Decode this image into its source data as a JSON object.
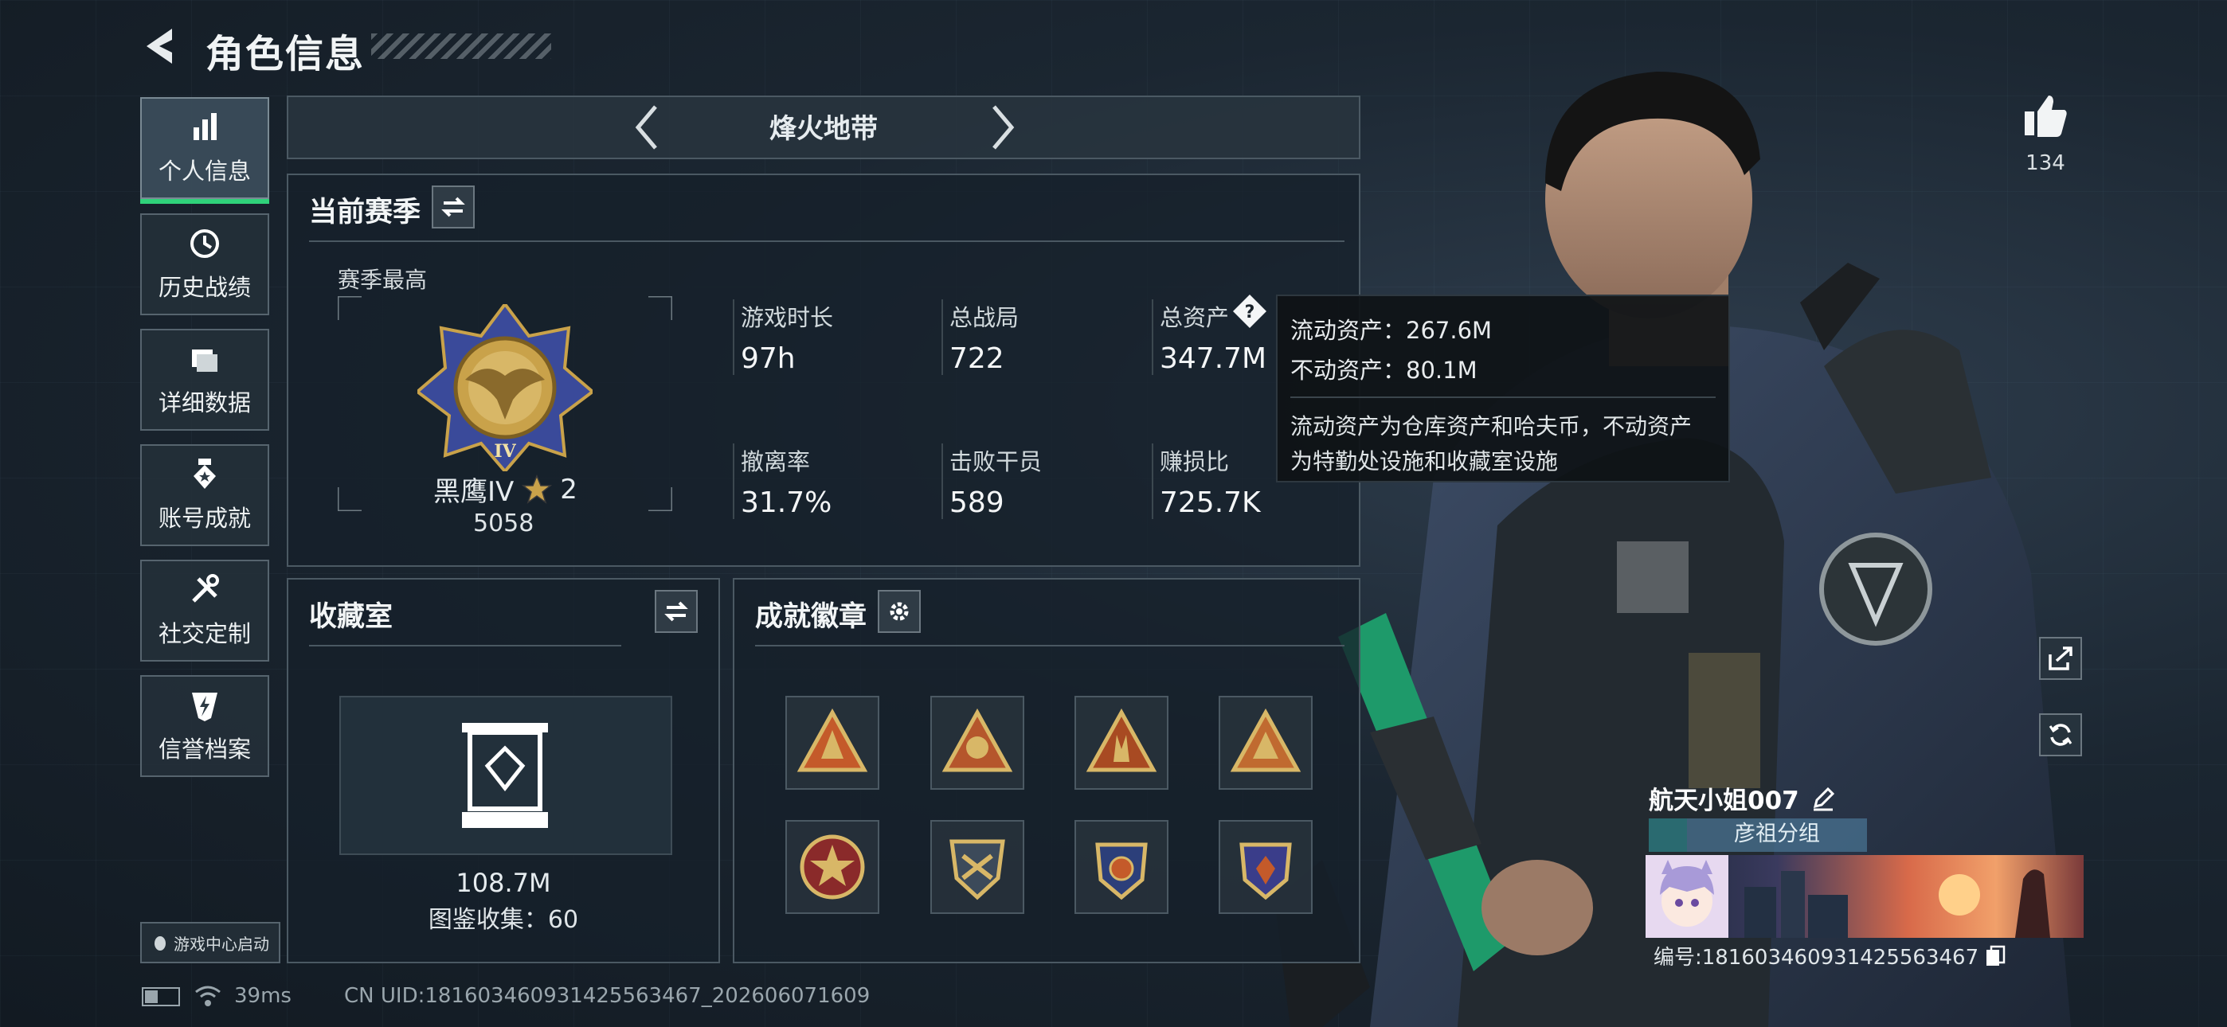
{
  "header": {
    "title": "角色信息"
  },
  "sidebar": {
    "items": [
      {
        "label": "个人信息",
        "active": true
      },
      {
        "label": "历史战绩"
      },
      {
        "label": "详细数据"
      },
      {
        "label": "账号成就"
      },
      {
        "label": "社交定制"
      },
      {
        "label": "信誉档案"
      }
    ],
    "launch_badge": "游戏中心启动"
  },
  "mode": {
    "title": "烽火地带"
  },
  "season": {
    "title": "当前赛季",
    "best_label": "赛季最高",
    "rank_name": "黑鹰IV",
    "rank_stars": "2",
    "rank_score": "5058",
    "rank_emblem_numeral": "IV",
    "stats": [
      {
        "label": "游戏时长",
        "value": "97h"
      },
      {
        "label": "总战局",
        "value": "722"
      },
      {
        "label": "总资产",
        "value": "347.7M"
      },
      {
        "label": "撤离率",
        "value": "31.7%"
      },
      {
        "label": "击败干员",
        "value": "589"
      },
      {
        "label": "赚损比",
        "value": "725.7K"
      }
    ]
  },
  "tooltip": {
    "liquid": "流动资产：267.6M",
    "fixed": "不动资产：80.1M",
    "desc_line1": "流动资产为仓库资产和哈夫币，不动资产",
    "desc_line2": "为特勤处设施和收藏室设施"
  },
  "collection": {
    "title": "收藏室",
    "value": "108.7M",
    "catalog": "图鉴收集：60"
  },
  "badges": {
    "title": "成就徽章"
  },
  "likes": {
    "count": "134"
  },
  "player": {
    "name": "航天小姐007",
    "group": "彦祖分组",
    "id_text": "编号:181603460931425563467"
  },
  "status": {
    "ping": "39ms",
    "uid": "CN UID:181603460931425563467_202606071609"
  },
  "colors": {
    "accent_green": "#2fd27a",
    "panel_border": "#4b5963",
    "gold": "#c9a24a"
  }
}
